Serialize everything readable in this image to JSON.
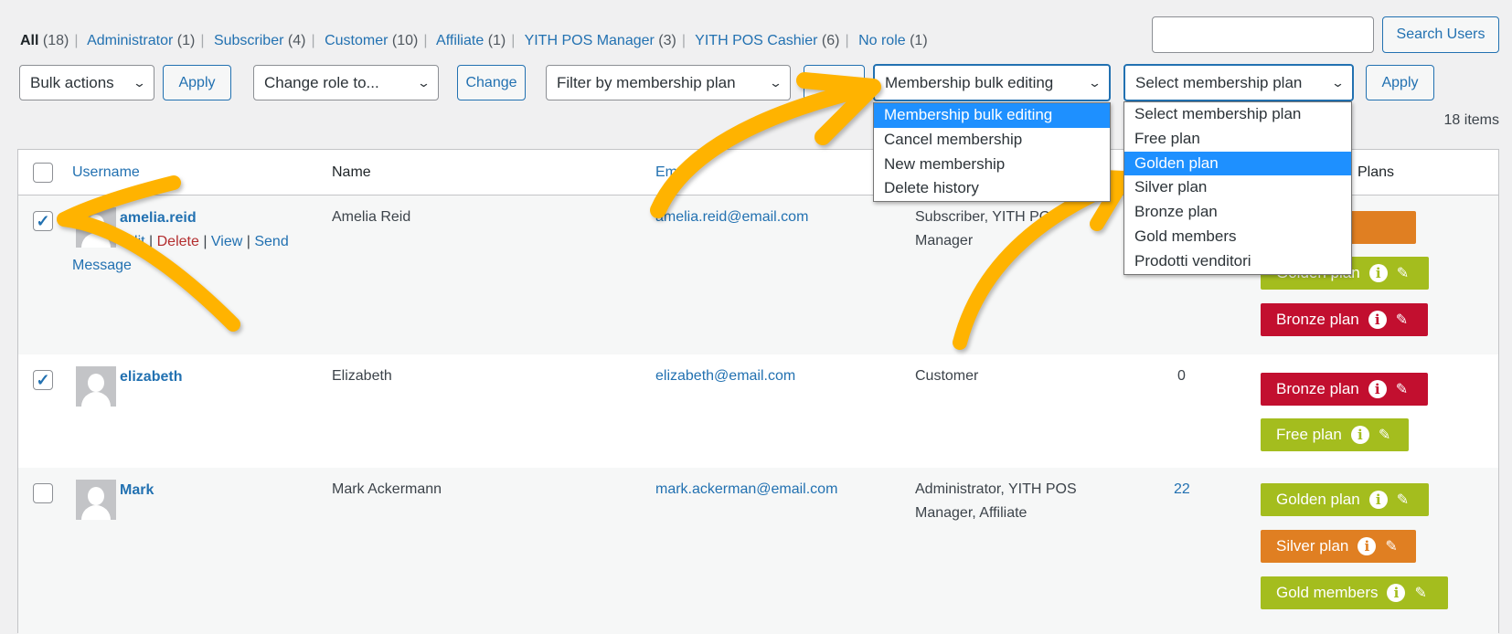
{
  "status_links": [
    {
      "label": "All",
      "count": "(18)",
      "current": true
    },
    {
      "label": "Administrator",
      "count": "(1)"
    },
    {
      "label": "Subscriber",
      "count": "(4)"
    },
    {
      "label": "Customer",
      "count": "(10)"
    },
    {
      "label": "Affiliate",
      "count": "(1)"
    },
    {
      "label": "YITH POS Manager",
      "count": "(3)"
    },
    {
      "label": "YITH POS Cashier",
      "count": "(6)"
    },
    {
      "label": "No role",
      "count": "(1)"
    }
  ],
  "search": {
    "value": "",
    "button": "Search Users"
  },
  "toolbar": {
    "bulk_actions": "Bulk actions",
    "apply": "Apply",
    "change_role": "Change role to...",
    "change": "Change",
    "filter_plan": "Filter by membership plan",
    "membership_bulk": "Membership bulk editing",
    "select_plan": "Select membership plan",
    "apply2": "Apply",
    "items_count": "18 items"
  },
  "bulk_dropdown": {
    "options": [
      "Membership bulk editing",
      "Cancel membership",
      "New membership",
      "Delete history"
    ],
    "highlighted": 0
  },
  "plan_dropdown": {
    "options": [
      "Select membership plan",
      "Free plan",
      "Golden plan",
      "Silver plan",
      "Bronze plan",
      "Gold members",
      "Prodotti venditori"
    ],
    "highlighted": 2
  },
  "table": {
    "headers": {
      "username": "Username",
      "name": "Name",
      "email": "Email",
      "plans": "Plans"
    },
    "rows": [
      {
        "username": "amelia.reid",
        "name": "Amelia Reid",
        "email": "amelia.reid@email.com",
        "role": "Subscriber, YITH POS Manager",
        "posts": "",
        "checked": true,
        "actions": {
          "edit": "Edit",
          "delete": "Delete",
          "view": "View",
          "send": "Send Message"
        },
        "plans": [
          {
            "label": "",
            "color": "#e07f22"
          },
          {
            "label": "Golden plan",
            "color": "#a4bd1e"
          },
          {
            "label": "Bronze plan",
            "color": "#c20f2f"
          }
        ]
      },
      {
        "username": "elizabeth",
        "name": "Elizabeth",
        "email": "elizabeth@email.com",
        "role": "Customer",
        "posts": "0",
        "checked": true,
        "plans": [
          {
            "label": "Bronze plan",
            "color": "#c20f2f"
          },
          {
            "label": "Free plan",
            "color": "#a4bd1e"
          }
        ]
      },
      {
        "username": "Mark",
        "name": "Mark Ackermann",
        "email": "mark.ackerman@email.com",
        "role": "Administrator, YITH POS Manager, Affiliate",
        "posts": "22",
        "checked": false,
        "plans": [
          {
            "label": "Golden plan",
            "color": "#a4bd1e"
          },
          {
            "label": "Silver plan",
            "color": "#e07f22"
          },
          {
            "label": "Gold members",
            "color": "#a4bd1e"
          }
        ]
      }
    ]
  },
  "colors": {
    "accent": "#2271b1",
    "highlight": "#1e90ff",
    "arrow": "#ffb300"
  }
}
